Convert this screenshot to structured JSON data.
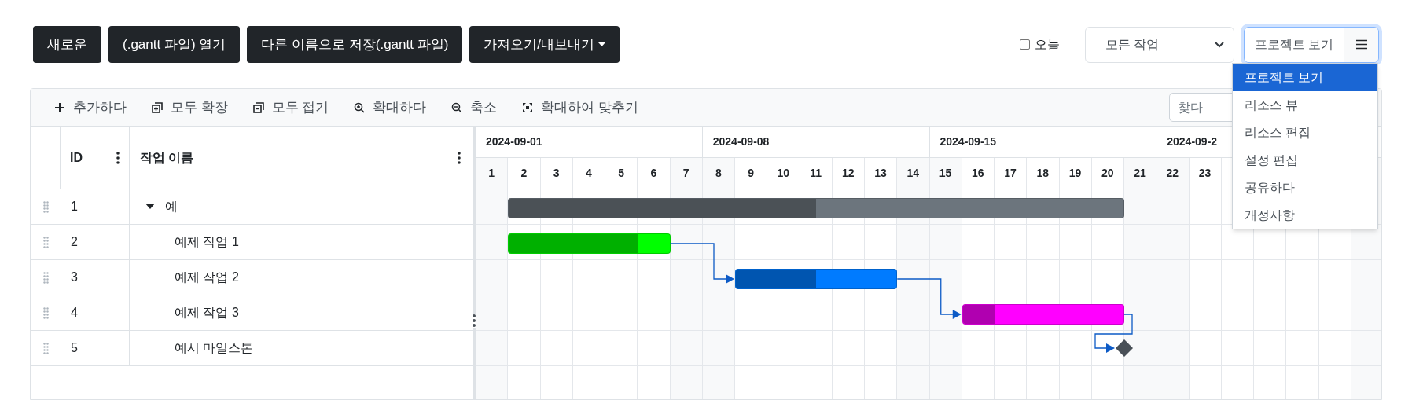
{
  "toolbar": {
    "buttons": [
      {
        "label": "새로운",
        "kind": "plain"
      },
      {
        "label": "(.gantt 파일) 열기",
        "kind": "plain"
      },
      {
        "label": "다른 이름으로 저장(.gantt 파일)",
        "kind": "plain"
      },
      {
        "label": "가져오기/내보내기",
        "kind": "dropdown"
      }
    ]
  },
  "today": {
    "label": "오늘",
    "checked": false
  },
  "filter": {
    "value": "모든 작업"
  },
  "view": {
    "label": "프로젝트 보기",
    "menu_open": true,
    "menu": [
      {
        "label": "프로젝트 보기",
        "selected": true
      },
      {
        "label": "리소스 뷰",
        "selected": false
      },
      {
        "label": "리소스 편집",
        "selected": false
      },
      {
        "label": "설정 편집",
        "selected": false
      },
      {
        "label": "공유하다",
        "selected": false
      },
      {
        "label": "개정사항",
        "selected": false
      }
    ]
  },
  "gantt_toolbar": {
    "actions": [
      {
        "label": "추가하다",
        "kind": "add"
      },
      {
        "label": "모두 확장",
        "kind": "expand"
      },
      {
        "label": "모두 접기",
        "kind": "collapse"
      },
      {
        "label": "확대하다",
        "kind": "zoom_in"
      },
      {
        "label": "축소",
        "kind": "zoom_out"
      },
      {
        "label": "확대하여 맞추기",
        "kind": "fit"
      }
    ],
    "search": {
      "placeholder": "찾다"
    }
  },
  "grid": {
    "columns": [
      {
        "label": "ID"
      },
      {
        "label": "작업 이름"
      }
    ],
    "rows": [
      {
        "number": "1",
        "name": "예",
        "kind": "summary",
        "expanded": true,
        "level": 0.5,
        "color": "#6c757d",
        "children": [
          {
            "number": "2",
            "name": "예제 작업 1",
            "kind": "task",
            "level": 0.8,
            "color": "#00ff00",
            "depends_on_previous": false
          },
          {
            "number": "3",
            "name": "예제 작업 2",
            "kind": "task",
            "level": 0.5,
            "color": "#007bff",
            "depends_on_previous": true
          },
          {
            "number": "4",
            "name": "예제 작업 3",
            "kind": "task",
            "level": 0.2,
            "color": "#ff00ff",
            "depends_on_previous": true
          },
          {
            "number": "5",
            "name": "예시 마일스톤",
            "kind": "milestone",
            "color": "#495057",
            "depends_on_previous": true
          }
        ]
      }
    ]
  },
  "timeline": {
    "weeks": [
      "2024-09-01",
      "2024-09-08",
      "2024-09-15",
      "2024-09-2"
    ],
    "days": [
      "1",
      "2",
      "3",
      "4",
      "5",
      "6",
      "7",
      "8",
      "9",
      "10",
      "11",
      "12",
      "13",
      "14",
      "15",
      "16",
      "17",
      "18",
      "19",
      "20",
      "21",
      "22",
      "23"
    ]
  }
}
